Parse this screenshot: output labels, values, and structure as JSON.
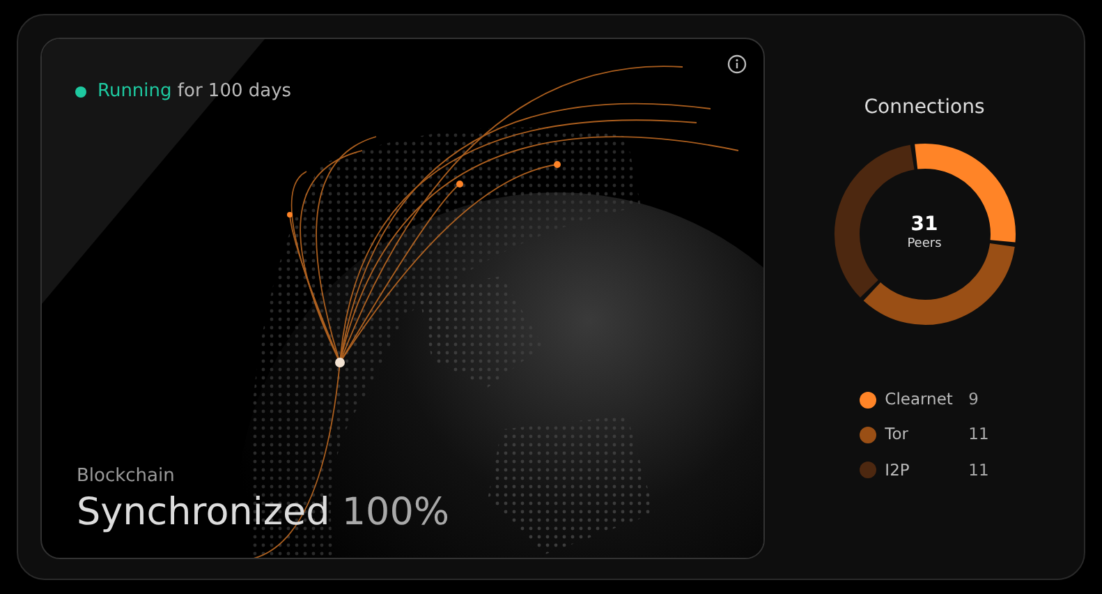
{
  "node": {
    "status": {
      "label": "Running",
      "detail": "for 100 days",
      "running": true
    },
    "blockchain": {
      "label": "Blockchain",
      "title": "Synchronized",
      "percent": "100%"
    }
  },
  "connections": {
    "title": "Connections",
    "total": "31",
    "total_label": "Peers",
    "legend": [
      {
        "name": "Clearnet",
        "count": "9",
        "color": "#ff8427"
      },
      {
        "name": "Tor",
        "count": "11",
        "color": "#9a4f15"
      },
      {
        "name": "I2P",
        "count": "11",
        "color": "#4d2810"
      }
    ]
  }
}
